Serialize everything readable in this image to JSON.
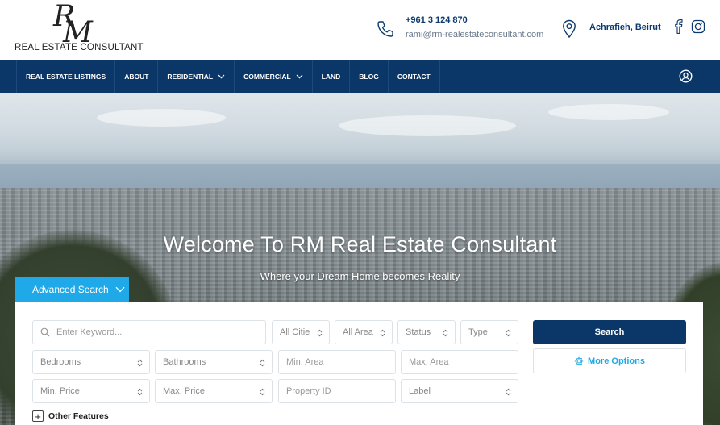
{
  "brand": {
    "monogram_r": "R",
    "monogram_m": "M",
    "name": "REAL ESTATE CONSULTANT"
  },
  "contact": {
    "phone": "+961 3 124 870",
    "email": "rami@rm-realestateconsultant.com",
    "location": "Achrafieh, Beirut"
  },
  "icons": {
    "phone": "phone-icon",
    "location": "map-pin-icon",
    "facebook": "facebook-icon",
    "instagram": "instagram-icon",
    "user": "user-circle-icon",
    "search": "magnifier-icon",
    "gear": "gear-icon"
  },
  "colors": {
    "navy": "#0a3668",
    "accent_blue": "#1fa9e8",
    "white": "#ffffff"
  },
  "nav": {
    "items": [
      {
        "label": "REAL ESTATE LISTINGS",
        "has_dropdown": false
      },
      {
        "label": "ABOUT",
        "has_dropdown": false
      },
      {
        "label": "RESIDENTIAL",
        "has_dropdown": true
      },
      {
        "label": "COMMERCIAL",
        "has_dropdown": true
      },
      {
        "label": "LAND",
        "has_dropdown": false
      },
      {
        "label": "BLOG",
        "has_dropdown": false
      },
      {
        "label": "CONTACT",
        "has_dropdown": false
      }
    ]
  },
  "hero": {
    "title": "Welcome To RM Real Estate Consultant",
    "subtitle": "Where your Dream Home becomes Reality"
  },
  "search": {
    "tab_label": "Advanced Search",
    "keyword_placeholder": "Enter Keyword...",
    "cities": "All Citie",
    "areas": "All Area",
    "status": "Status",
    "type": "Type",
    "bedrooms": "Bedrooms",
    "bathrooms": "Bathrooms",
    "min_area_placeholder": "Min. Area",
    "max_area_placeholder": "Max. Area",
    "min_price": "Min. Price",
    "max_price": "Max. Price",
    "property_id_placeholder": "Property ID",
    "label": "Label",
    "search_button": "Search",
    "more_options": "More Options",
    "other_features": "Other Features",
    "plus": "+"
  }
}
